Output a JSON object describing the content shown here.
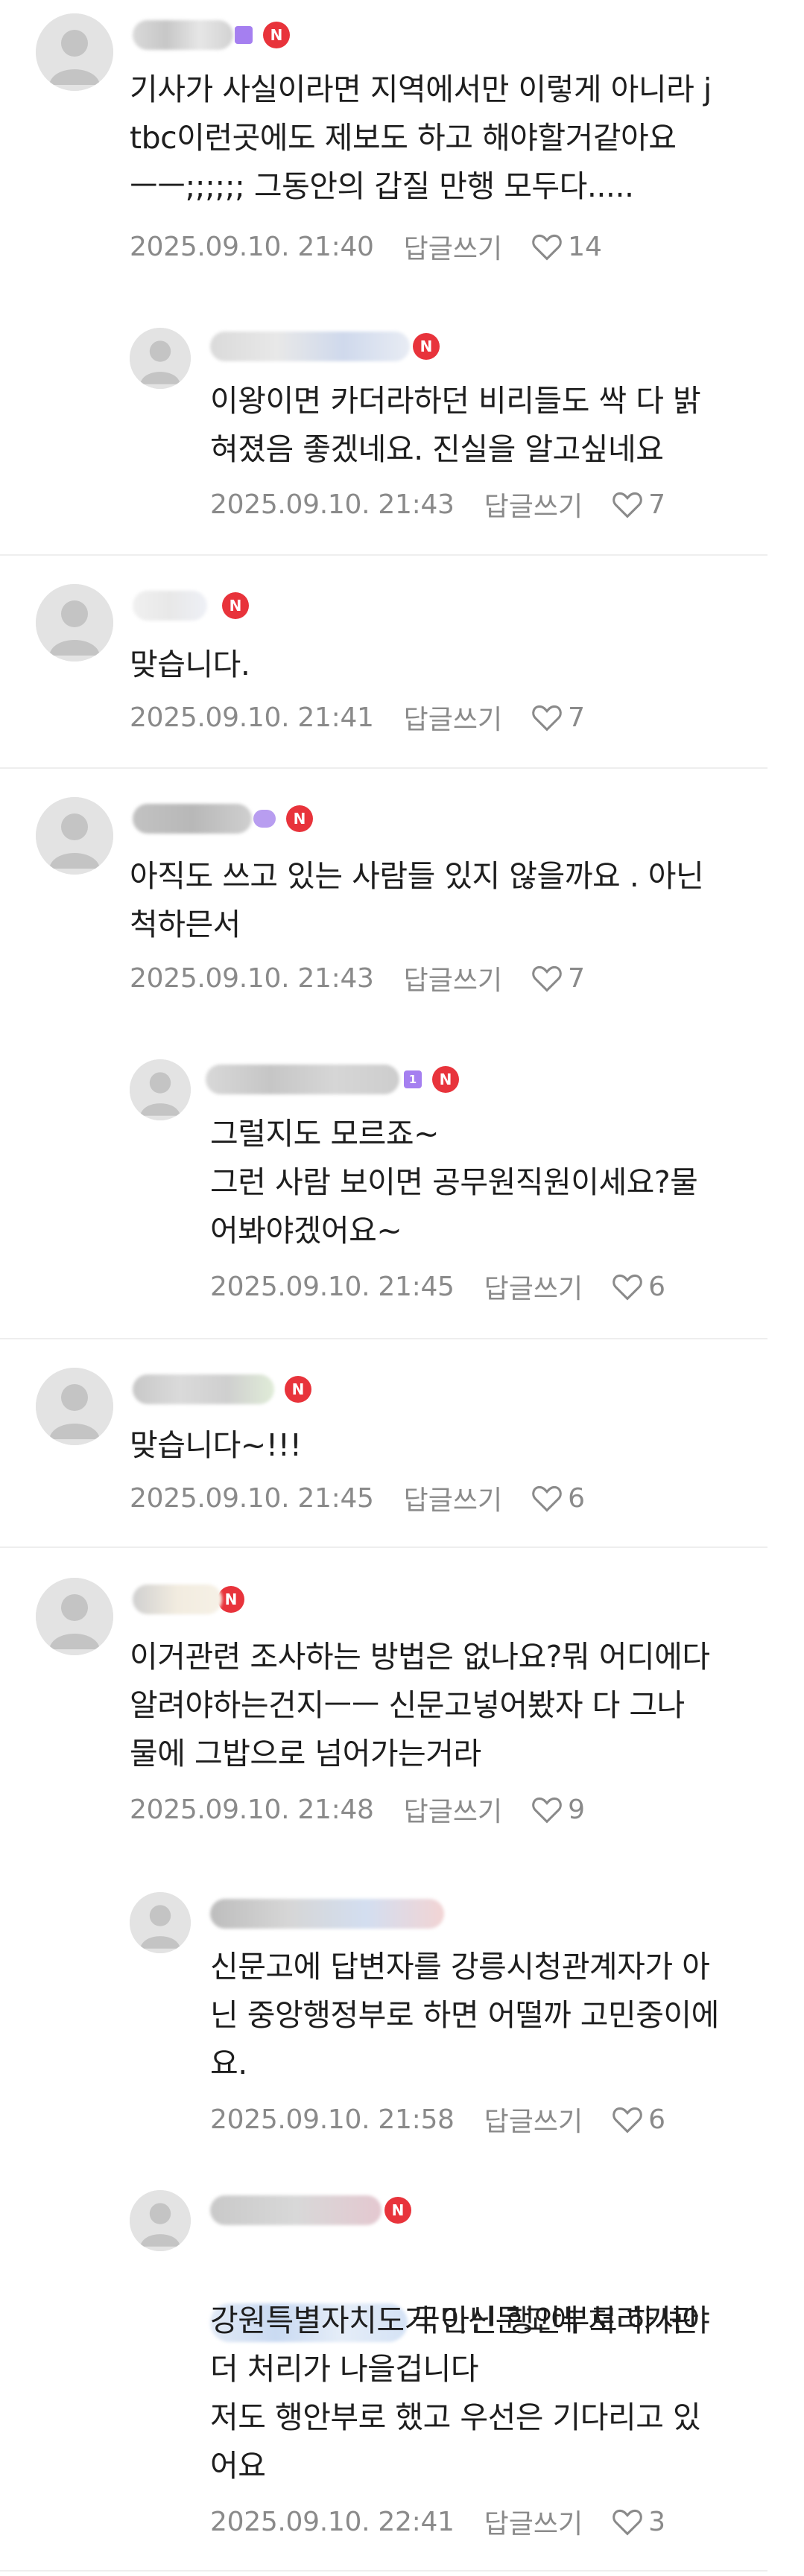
{
  "reply_label": "답글쓰기",
  "colors": {
    "new_badge": "#e8333b",
    "text": "#1e1e1e",
    "meta": "#8a8a8a",
    "divider": "#eeeeee"
  },
  "icons": {
    "like": "heart-outline-icon",
    "avatar": "default-profile-icon",
    "new": "new-badge-icon"
  },
  "comments": [
    {
      "id": "c1",
      "new_badge": "N",
      "text": "기사가 사실이라면 지역에서만 이렇게 아니라 j\ntbc이런곳에도 제보도 하고 해야할거같아요\nㅡㅡ;;;;;; 그동안의 갑질 만행 모두다.....",
      "date": "2025.09.10. 21:40",
      "likes": "14"
    },
    {
      "id": "c2",
      "new_badge": "N",
      "text": "이왕이면 카더라하던 비리들도 싹 다 밝\n혀졌음 좋겠네요. 진실을 알고싶네요",
      "date": "2025.09.10. 21:43",
      "likes": "7"
    },
    {
      "id": "c3",
      "new_badge": "N",
      "text": "맞습니다.",
      "date": "2025.09.10. 21:41",
      "likes": "7"
    },
    {
      "id": "c4",
      "new_badge": "N",
      "text": "아직도 쓰고 있는 사람들 있지 않을까요 . 아닌\n척하믄서",
      "date": "2025.09.10. 21:43",
      "likes": "7"
    },
    {
      "id": "c5",
      "level": "1",
      "new_badge": "N",
      "text": "그럴지도 모르죠~\n그런 사람 보이면 공무원직원이세요?물\n어봐야겠어요~",
      "date": "2025.09.10. 21:45",
      "likes": "6"
    },
    {
      "id": "c6",
      "new_badge": "N",
      "text": "맞습니다~!!!",
      "date": "2025.09.10. 21:45",
      "likes": "6"
    },
    {
      "id": "c7",
      "new_badge": "N",
      "text": "이거관련 조사하는 방법은 없나요?뭐 어디에다\n알려야하는건지ㅡㅡ 신문고넣어봤자 다 그나\n물에 그밥으로 넘어가는거라",
      "date": "2025.09.10. 21:48",
      "likes": "9"
    },
    {
      "id": "c8",
      "text": "신문고에 답변자를 강릉시청관계자가 아\n닌 중앙행정부로 하면 어떨까 고민중이에\n요.",
      "date": "2025.09.10. 21:58",
      "likes": "6"
    },
    {
      "id": "c9",
      "new_badge": "N",
      "text_first": "국민신문고에 처리기관",
      "text": "강원특별자치도가 아닌 행안부로 하셔야\n더 처리가 나을겁니다\n저도 행안부로 했고 우선은 기다리고 있\n어요",
      "date": "2025.09.10. 22:41",
      "likes": "3"
    }
  ]
}
